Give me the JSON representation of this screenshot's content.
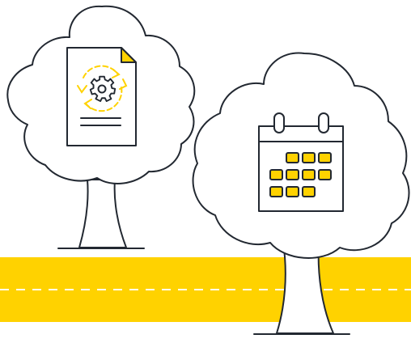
{
  "colors": {
    "accent": "#FFD200",
    "ink": "#222831",
    "background": "#FFFFFF",
    "road_dash": "#FFFFFF"
  },
  "icons": {
    "left_tree": "document-with-gear-and-refresh-icon",
    "right_tree": "calendar-icon"
  }
}
